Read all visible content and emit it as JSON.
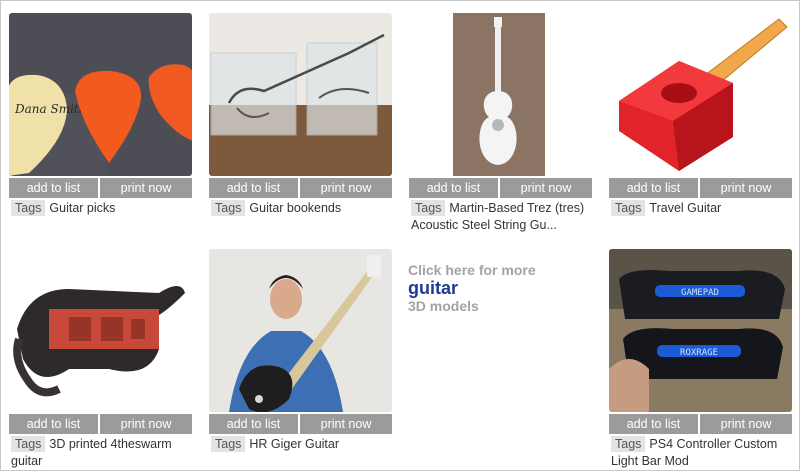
{
  "items": [
    {
      "add": "add to list",
      "print": "print now",
      "tag": "Tags",
      "title": "Guitar picks"
    },
    {
      "add": "add to list",
      "print": "print now",
      "tag": "Tags",
      "title": "Guitar bookends"
    },
    {
      "add": "add to list",
      "print": "print now",
      "tag": "Tags",
      "title": "Martin-Based Trez (tres) Acoustic Steel String Gu..."
    },
    {
      "add": "add to list",
      "print": "print now",
      "tag": "Tags",
      "title": "Travel Guitar"
    },
    {
      "add": "add to list",
      "print": "print now",
      "tag": "Tags",
      "title": "3D printed 4theswarm guitar"
    },
    {
      "add": "add to list",
      "print": "print now",
      "tag": "Tags",
      "title": "HR Giger Guitar"
    },
    {
      "add": "add to list",
      "print": "print now",
      "tag": "Tags",
      "title": "PS4 Controller Custom Light Bar Mod"
    }
  ],
  "more": {
    "line1": "Click here for more",
    "keyword": "guitar",
    "line3": "3D models"
  },
  "thumbs": {
    "controller_label_top": "GAMEPAD",
    "controller_label_bottom": "ROXRAGE",
    "pick_signature": "Dana Smith"
  },
  "colors": {
    "button_bg": "#9b9b9b",
    "tag_bg": "#e3e3e3",
    "link_blue": "#1d3a96",
    "muted_text": "#a3a3a3"
  }
}
